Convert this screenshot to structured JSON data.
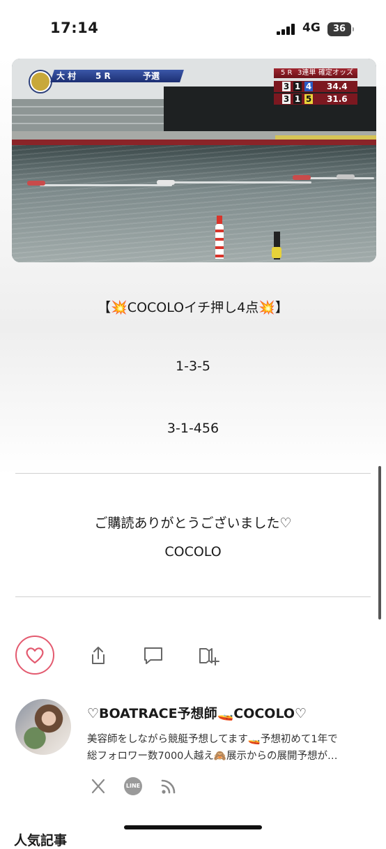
{
  "status_bar": {
    "time": "17:14",
    "network": "4G",
    "battery": "36"
  },
  "race_image": {
    "venue": "大 村",
    "race_number": "5 R",
    "race_type": "予選",
    "odds_header": [
      "5 R",
      "3連単",
      "確定オッズ"
    ],
    "odds_rows": [
      {
        "combo": [
          "3",
          "1",
          "4"
        ],
        "odds": "34.4"
      },
      {
        "combo": [
          "3",
          "1",
          "5"
        ],
        "odds": "31.6"
      }
    ]
  },
  "article": {
    "headline": "【💥COCOLOイチ押し4点💥】",
    "pick_1": "1-3-5",
    "pick_2": "3-1-456",
    "thanks": "ご購読ありがとうございました♡",
    "signature": "COCOLO"
  },
  "actions": {
    "like": "heart-icon",
    "share": "share-icon",
    "comment": "comment-icon",
    "save": "bookmark-add-icon"
  },
  "author": {
    "name": "♡BOATRACE予想師🚤COCOLO♡",
    "bio_line_1": "美容師をしながら競艇予想してます🚤予想初めて1年で",
    "bio_line_2": "総フォロワー数7000人越え🙈展示からの展開予想が…",
    "social": [
      "x-icon",
      "line-icon",
      "rss-icon"
    ],
    "line_label": "LINE"
  },
  "next_section": {
    "heading": "人気記事"
  }
}
